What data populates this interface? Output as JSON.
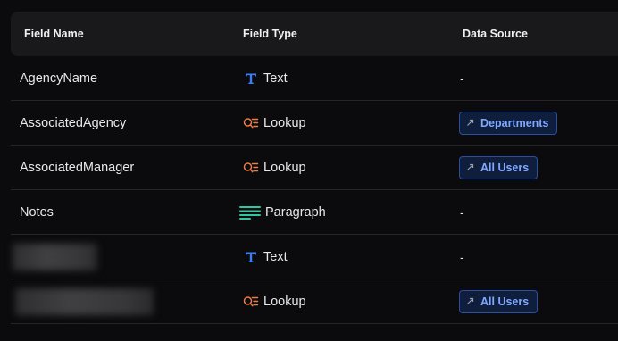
{
  "columns": {
    "field_name": "Field Name",
    "field_type": "Field Type",
    "data_source": "Data Source"
  },
  "rows": [
    {
      "name": "AgencyName",
      "type": "Text",
      "type_icon": "text-t-icon",
      "source": "-"
    },
    {
      "name": "AssociatedAgency",
      "type": "Lookup",
      "type_icon": "lookup-icon",
      "source_badge": "Departments"
    },
    {
      "name": "AssociatedManager",
      "type": "Lookup",
      "type_icon": "lookup-icon",
      "source_badge": "All Users"
    },
    {
      "name": "Notes",
      "type": "Paragraph",
      "type_icon": "paragraph-icon",
      "source": "-"
    },
    {
      "name_redacted": true,
      "type": "Text",
      "type_icon": "text-t-icon",
      "source": "-"
    },
    {
      "name_redacted": true,
      "type": "Lookup",
      "type_icon": "lookup-icon",
      "source_badge": "All Users"
    }
  ],
  "colors": {
    "background": "#0b0b0d",
    "header_bg": "#19191c",
    "text_icon": "#3f7cf0",
    "lookup_icon": "#f07a45",
    "paragraph_icon": "#2fc7a0",
    "badge_text": "#7fa8ff",
    "badge_border": "#2b4fa0"
  }
}
